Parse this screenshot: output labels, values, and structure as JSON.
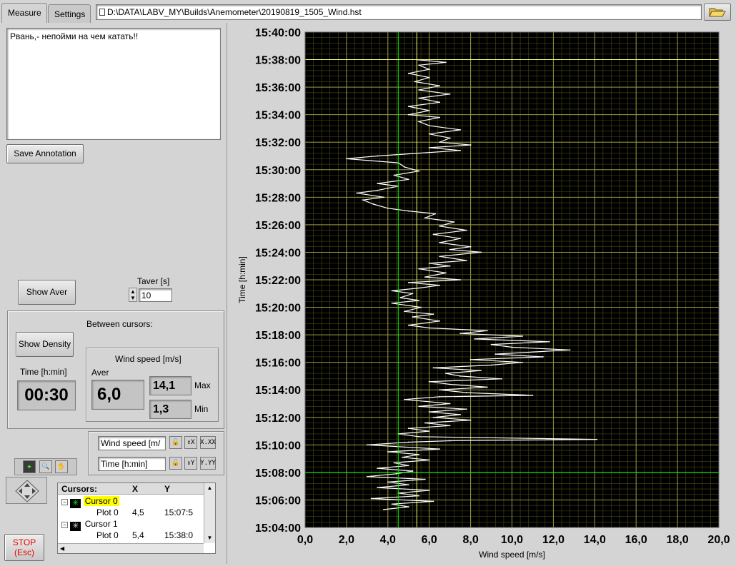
{
  "tabs": [
    {
      "label": "Measure",
      "active": true
    },
    {
      "label": "Settings",
      "active": false
    }
  ],
  "file_path": "D:\\DATA\\LABV_MY\\Builds\\Anemometer\\20190819_1505_Wind.hst",
  "annotation_text": "Рвань,- непойми на чем катать!!",
  "save_annotation_label": "Save Annotation",
  "show_aver_label": "Show Aver",
  "taver": {
    "label": "Taver [s]",
    "value": "10"
  },
  "between_cursors": {
    "title": "Between cursors:",
    "show_density_label": "Show Density",
    "time_label": "Time [h:min]",
    "time_value": "00:30",
    "wind_group_label": "Wind speed [m/s]",
    "aver_label": "Aver",
    "aver_value": "6,0",
    "max_value": "14,1",
    "max_label": "Max",
    "min_value": "1,3",
    "min_label": "Min"
  },
  "axis_controls": {
    "x_name": "Wind speed [m/",
    "y_name": "Time [h:min]",
    "x_scale_label": "X.XX",
    "y_scale_label": "Y.YY"
  },
  "cursors_table": {
    "headers": [
      "Cursors:",
      "X",
      "Y"
    ],
    "rows": [
      {
        "name": "Cursor 0",
        "plot": "Plot 0",
        "x": "4,5",
        "y": "15:07:5",
        "color": "#00ff00",
        "highlight": true
      },
      {
        "name": "Cursor 1",
        "plot": "Plot 0",
        "x": "5,4",
        "y": "15:38:0",
        "color": "#ffff80",
        "highlight": false
      }
    ]
  },
  "stop_button": {
    "line1": "STOP",
    "line2": "(Esc)"
  },
  "chart_data": {
    "type": "line",
    "xlabel": "Wind speed [m/s]",
    "ylabel": "Time [h:min]",
    "xlim": [
      0,
      20
    ],
    "x_ticks": [
      "0,0",
      "2,0",
      "4,0",
      "6,0",
      "8,0",
      "10,0",
      "12,0",
      "14,0",
      "16,0",
      "18,0",
      "20,0"
    ],
    "y_ticks": [
      "15:40:00",
      "15:38:00",
      "15:36:00",
      "15:34:00",
      "15:32:00",
      "15:30:00",
      "15:28:00",
      "15:26:00",
      "15:24:00",
      "15:22:00",
      "15:20:00",
      "15:18:00",
      "15:16:00",
      "15:14:00",
      "15:12:00",
      "15:10:00",
      "15:08:00",
      "15:06:00",
      "15:04:00"
    ],
    "ylim_minutes": [
      4,
      40
    ],
    "grid": true,
    "background": "#000000",
    "line_color": "#ffffff",
    "series": [
      {
        "points": [
          [
            3.8,
            5.3
          ],
          [
            5.0,
            5.5
          ],
          [
            4.2,
            5.7
          ],
          [
            6.2,
            5.9
          ],
          [
            3.2,
            6.1
          ],
          [
            5.5,
            6.3
          ],
          [
            4.5,
            6.5
          ],
          [
            6.0,
            6.7
          ],
          [
            3.5,
            6.9
          ],
          [
            5.0,
            7.1
          ],
          [
            4.0,
            7.3
          ],
          [
            5.8,
            7.5
          ],
          [
            3.0,
            7.7
          ],
          [
            4.4,
            7.9
          ],
          [
            5.2,
            8.1
          ],
          [
            3.5,
            8.3
          ],
          [
            5.0,
            8.5
          ],
          [
            4.3,
            8.7
          ],
          [
            6.0,
            8.9
          ],
          [
            4.7,
            9.1
          ],
          [
            5.5,
            9.3
          ],
          [
            4.0,
            9.5
          ],
          [
            6.5,
            9.7
          ],
          [
            3.0,
            10.0
          ],
          [
            5.0,
            10.2
          ],
          [
            7.0,
            10.3
          ],
          [
            14.1,
            10.4
          ],
          [
            5.5,
            10.6
          ],
          [
            4.5,
            10.8
          ],
          [
            6.0,
            11.0
          ],
          [
            5.0,
            11.2
          ],
          [
            7.0,
            11.4
          ],
          [
            5.8,
            11.6
          ],
          [
            8.0,
            11.8
          ],
          [
            6.2,
            12.0
          ],
          [
            7.5,
            12.2
          ],
          [
            6.0,
            12.4
          ],
          [
            7.8,
            12.6
          ],
          [
            5.5,
            12.8
          ],
          [
            7.0,
            13.0
          ],
          [
            4.8,
            13.3
          ],
          [
            6.5,
            13.5
          ],
          [
            11.0,
            13.6
          ],
          [
            7.8,
            13.8
          ],
          [
            6.5,
            14.0
          ],
          [
            8.8,
            14.2
          ],
          [
            7.0,
            14.4
          ],
          [
            6.0,
            14.6
          ],
          [
            9.5,
            14.8
          ],
          [
            7.5,
            15.0
          ],
          [
            6.8,
            15.2
          ],
          [
            8.5,
            15.4
          ],
          [
            6.2,
            15.6
          ],
          [
            9.0,
            15.8
          ],
          [
            10.5,
            16.0
          ],
          [
            8.0,
            16.2
          ],
          [
            11.5,
            16.4
          ],
          [
            9.2,
            16.6
          ],
          [
            12.8,
            16.9
          ],
          [
            10.0,
            17.1
          ],
          [
            9.0,
            17.3
          ],
          [
            11.8,
            17.5
          ],
          [
            8.2,
            17.7
          ],
          [
            10.5,
            17.9
          ],
          [
            7.5,
            18.1
          ],
          [
            8.8,
            18.3
          ],
          [
            6.0,
            18.5
          ],
          [
            5.0,
            18.7
          ],
          [
            6.5,
            19.0
          ],
          [
            5.2,
            19.3
          ],
          [
            6.2,
            19.5
          ],
          [
            4.8,
            19.7
          ],
          [
            5.6,
            20.0
          ],
          [
            4.2,
            20.3
          ],
          [
            5.5,
            20.5
          ],
          [
            4.6,
            20.7
          ],
          [
            5.2,
            21.0
          ],
          [
            4.2,
            21.2
          ],
          [
            5.5,
            21.4
          ],
          [
            6.5,
            21.6
          ],
          [
            5.0,
            21.8
          ],
          [
            7.5,
            22.0
          ],
          [
            5.8,
            22.2
          ],
          [
            6.8,
            22.5
          ],
          [
            5.5,
            22.8
          ],
          [
            7.0,
            23.0
          ],
          [
            6.0,
            23.2
          ],
          [
            7.8,
            23.4
          ],
          [
            6.5,
            23.7
          ],
          [
            8.5,
            24.0
          ],
          [
            7.0,
            24.2
          ],
          [
            8.0,
            24.4
          ],
          [
            6.5,
            24.7
          ],
          [
            7.5,
            25.0
          ],
          [
            6.2,
            25.3
          ],
          [
            7.8,
            25.6
          ],
          [
            6.5,
            25.9
          ],
          [
            7.2,
            26.2
          ],
          [
            5.8,
            26.5
          ],
          [
            6.3,
            26.8
          ],
          [
            5.0,
            27.0
          ],
          [
            4.0,
            27.2
          ],
          [
            3.3,
            27.5
          ],
          [
            2.8,
            27.8
          ],
          [
            3.8,
            28.0
          ],
          [
            2.5,
            28.3
          ],
          [
            3.5,
            28.5
          ],
          [
            4.5,
            28.8
          ],
          [
            3.5,
            29.0
          ],
          [
            5.0,
            29.3
          ],
          [
            4.3,
            29.6
          ],
          [
            5.5,
            29.9
          ],
          [
            4.8,
            30.2
          ],
          [
            4.5,
            30.5
          ],
          [
            2.0,
            30.8
          ],
          [
            3.5,
            31.0
          ],
          [
            5.5,
            31.2
          ],
          [
            7.5,
            31.4
          ],
          [
            6.0,
            31.6
          ],
          [
            8.0,
            31.8
          ],
          [
            6.5,
            32.0
          ],
          [
            7.0,
            32.3
          ],
          [
            6.0,
            32.6
          ],
          [
            7.5,
            32.9
          ],
          [
            6.0,
            33.2
          ],
          [
            5.5,
            33.5
          ],
          [
            6.5,
            33.8
          ],
          [
            5.0,
            34.0
          ],
          [
            6.0,
            34.3
          ],
          [
            5.0,
            34.6
          ],
          [
            6.5,
            34.9
          ],
          [
            5.5,
            35.2
          ],
          [
            7.0,
            35.5
          ],
          [
            5.5,
            35.8
          ],
          [
            6.5,
            36.1
          ],
          [
            5.3,
            36.4
          ],
          [
            6.0,
            36.7
          ],
          [
            5.0,
            37.0
          ],
          [
            6.0,
            37.3
          ],
          [
            5.5,
            37.6
          ],
          [
            6.8,
            37.8
          ],
          [
            5.4,
            38.0
          ]
        ]
      }
    ],
    "cursors": [
      {
        "name": "Cursor 0",
        "x": 4.5,
        "y_minutes": 8.0,
        "color": "#00ff00"
      },
      {
        "name": "Cursor 1",
        "x": 5.4,
        "y_minutes": 38.0,
        "color": "#ffff80"
      }
    ]
  }
}
